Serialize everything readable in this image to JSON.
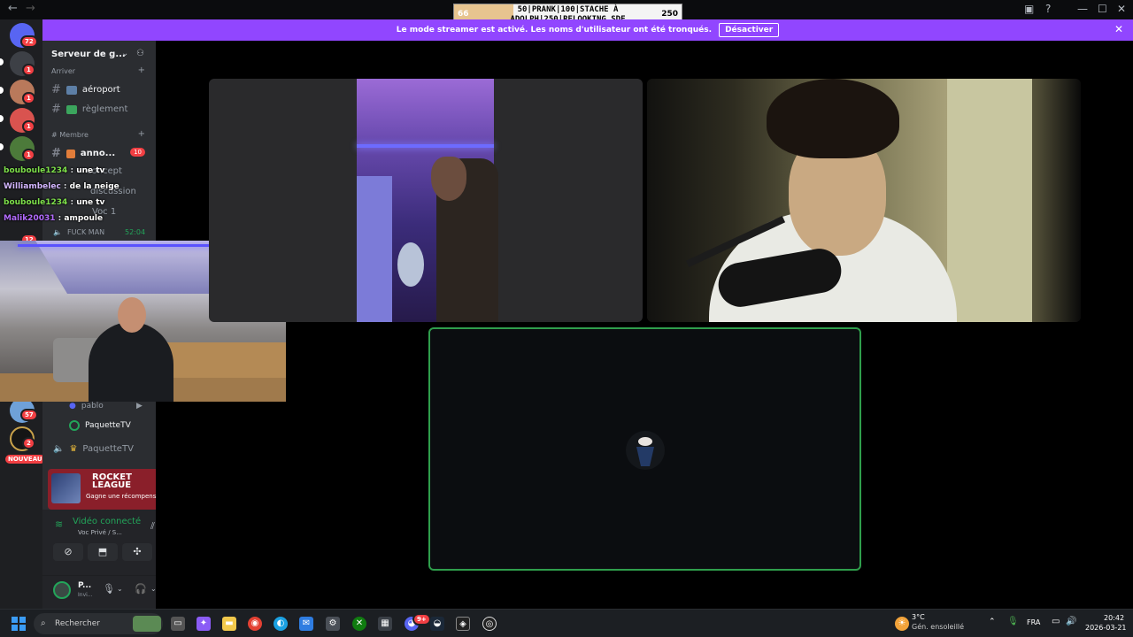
{
  "overlay_goal": {
    "left_value": "66",
    "right_value": "250",
    "line1": "50|PRANK|100|STACHE À",
    "line2": "ADOLPH|250|RELOOKING SDF",
    "progress_fraction": 0.26
  },
  "banner": {
    "message": "Le mode streamer est activé. Les noms d'utilisateur ont été tronqués.",
    "disable_label": "Désactiver",
    "close_icon": "close-icon"
  },
  "rail": {
    "badges": [
      "72",
      "1",
      "1",
      "1",
      "1",
      "12",
      "57",
      "2"
    ],
    "new_label": "NOUVEAU"
  },
  "sidebar": {
    "server_name": "Serveur de g...",
    "categories": [
      "Arriver",
      "# Membre"
    ],
    "channels": [
      "aéroport",
      "règlement",
      "anno...",
      "concept",
      "discussion",
      "Voc 1",
      "FUCK MAN"
    ],
    "unread_count": "10",
    "voice_time": "52:04",
    "voice_users": [
      "pablo",
      "PaquetteTV",
      "PaquetteTV"
    ]
  },
  "chat": [
    {
      "user": "bouboule1234",
      "msg": "une tv",
      "color": "#7ee04b"
    },
    {
      "user": "Williambelec",
      "msg": "de la neige",
      "color": "#d3b6ff"
    },
    {
      "user": "bouboule1234",
      "msg": "une tv",
      "color": "#7ee04b"
    },
    {
      "user": "Malik20031",
      "msg": "ampoule",
      "color": "#b36bff"
    }
  ],
  "promo": {
    "title": "ROCKET LEAGUE",
    "subtitle": "Gagne une récompense !"
  },
  "voice_panel": {
    "status": "Vidéo connecté",
    "sub": "Voc Privé / S..."
  },
  "user": {
    "name": "P...",
    "status": "Invi..."
  },
  "taskbar": {
    "search_placeholder": "Rechercher",
    "weather_temp": "3°C",
    "weather_desc": "Gén. ensoleillé",
    "lang": "FRA",
    "time": "20:42",
    "date": "2026-03-21",
    "discord_badge": "9+"
  },
  "colors": {
    "banner": "#9146ff",
    "speaking_border": "#2f9e4c",
    "connected": "#23a55a"
  }
}
